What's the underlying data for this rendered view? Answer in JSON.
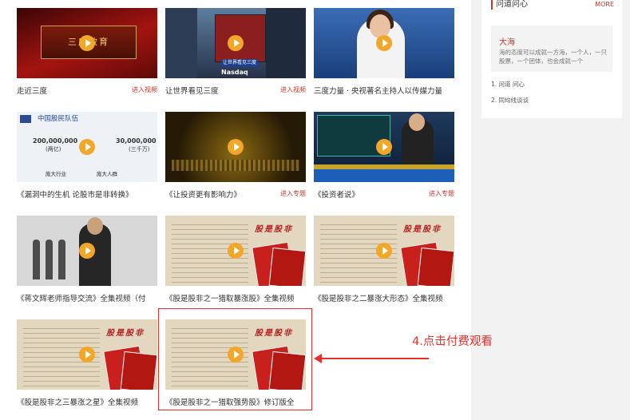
{
  "videos": [
    {
      "caption": "走近三度",
      "link": "进入视频",
      "thumb_text": "三度教育"
    },
    {
      "caption": "让世界看见三度",
      "link": "进入视频",
      "thumb_text": "让世界看见三度",
      "thumb_text2": "Nasdaq"
    },
    {
      "caption": "三度力量 · 央视著名主持人以传媒力量"
    },
    {
      "caption": "《漏洞中的生机 论股市是非转换》",
      "thumb_title": "中国股民队伍",
      "thumb_n1": "200,000,000",
      "thumb_s1": "(两亿)",
      "thumb_n2": "30,000,000",
      "thumb_s2": "(三千万)",
      "thumb_b1": "庞大行业",
      "thumb_b2": "庞大人群"
    },
    {
      "caption": "《让投资更有影响力》",
      "link": "进入专题"
    },
    {
      "caption": "《投资者说》",
      "link": "进入专题"
    },
    {
      "caption": "《蒋文辉老师指导交流》全集视频（付"
    },
    {
      "caption": "《股是股非之一猎取暴涨股》全集视频",
      "thumb_title": "股是股非"
    },
    {
      "caption": "《股是股非之二暴涨大形态》全集视频",
      "thumb_title": "股是股非"
    },
    {
      "caption": "《股是股非之三暴涨之星》全集视频",
      "thumb_title": "股是股非"
    },
    {
      "caption": "《股是股非之一猎取强势股》修订版全",
      "thumb_title": "股是股非"
    }
  ],
  "sidebar": {
    "heading": "问道问心",
    "more": "MORE",
    "featured": {
      "name": "大海",
      "desc": "海的态度可以成就一方海，一个人，一只股票，一个团体，也会成就一个"
    },
    "items": [
      "1. 问道 问心",
      "2. 同均线谈谈"
    ]
  },
  "annotation": {
    "text": "4.点击付费观看",
    "color": "#e8302a"
  },
  "colors": {
    "accent": "#c0392b",
    "play": "#f3a72a"
  }
}
